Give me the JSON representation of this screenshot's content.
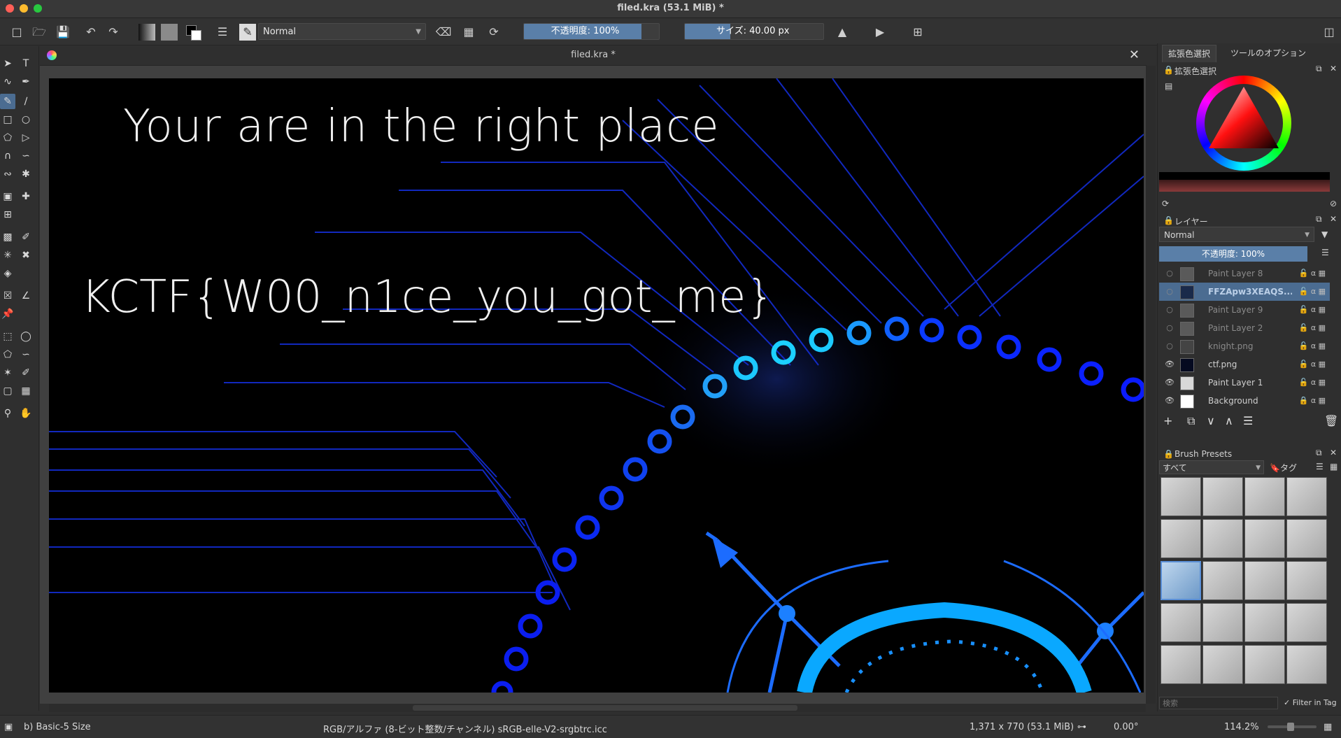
{
  "window": {
    "title": "filed.kra (53.1 MiB)  *"
  },
  "toolbar": {
    "blend_mode": "Normal",
    "opacity_label": "不透明度: 100%",
    "size_label": "サイズ: 40.00 px",
    "icons": [
      "new-document-icon",
      "open-folder-icon",
      "save-icon",
      "undo-icon",
      "redo-icon",
      "gradient-icon",
      "pattern-icon",
      "color-swap-icon",
      "brush-settings-icon",
      "brush-preset-icon",
      "eraser-icon",
      "alpha-lock-icon",
      "reload-icon",
      "mirror-horizontal-icon",
      "mirror-vertical-icon",
      "wrap-icon",
      "docker-toggle-icon"
    ]
  },
  "document": {
    "tab_title": "filed.kra *",
    "close_glyph": "✕"
  },
  "canvas": {
    "text_top": "Your are in the right place",
    "text_flag": "KCTF{W00_n1ce_you_got_me}"
  },
  "right_panel": {
    "tabs": [
      "拡張色選択",
      "ツールのオプション"
    ],
    "color_panel_title": "拡張色選択",
    "layers": {
      "title": "レイヤー",
      "blend_mode": "Normal",
      "opacity_label": "不透明度: 100%",
      "items": [
        {
          "name": "Paint Layer 8",
          "visible": false,
          "selected": false
        },
        {
          "name": "FFZApw3XEAQS...",
          "visible": false,
          "selected": true
        },
        {
          "name": "Paint Layer 9",
          "visible": false,
          "selected": false
        },
        {
          "name": "Paint Layer 2",
          "visible": false,
          "selected": false
        },
        {
          "name": "knight.png",
          "visible": false,
          "selected": false
        },
        {
          "name": "ctf.png",
          "visible": true,
          "selected": false
        },
        {
          "name": "Paint Layer 1",
          "visible": true,
          "selected": false
        },
        {
          "name": "Background",
          "visible": true,
          "selected": false
        }
      ]
    },
    "brush_presets": {
      "title": "Brush Presets",
      "filter_value": "すべて",
      "tag_label": "タグ",
      "search_placeholder": "検索",
      "filter_in_tag_label": "Filter in Tag"
    }
  },
  "statusbar": {
    "brush": "b) Basic-5 Size",
    "color_space": "RGB/アルファ (8-ビット整数/チャンネル)  sRGB-elle-V2-srgbtrc.icc",
    "image_size": "1,371 x 770 (53.1 MiB)",
    "rotation": "0.00°",
    "zoom": "114.2%"
  },
  "colors": {
    "accent": "#4b6c91",
    "canvas_bg": "#000000",
    "circuit": "#1a3cff",
    "cyan": "#00c8ff"
  }
}
